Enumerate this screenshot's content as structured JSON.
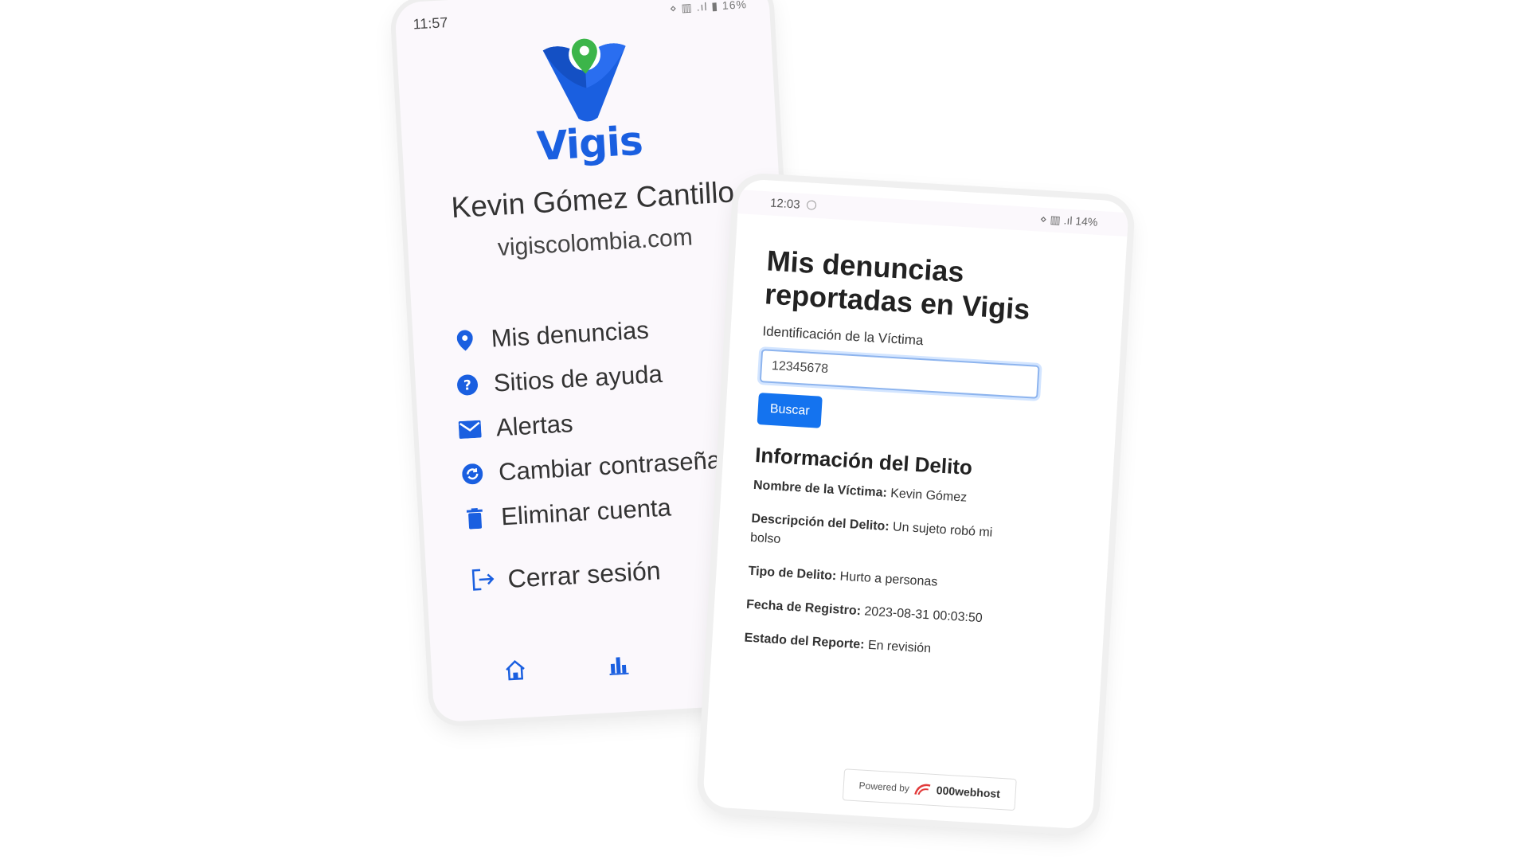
{
  "phone1": {
    "status_time": "11:57",
    "status_icons": "⋄ ▥ .ıl ▮ 16%",
    "logo_text": "Vigis",
    "user_name": "Kevin Gómez Cantillo",
    "user_site": "vigiscolombia.com",
    "menu": [
      {
        "label": "Mis denuncias",
        "icon": "location-pin-icon"
      },
      {
        "label": "Sitios de ayuda",
        "icon": "help-circle-icon"
      },
      {
        "label": "Alertas",
        "icon": "mail-icon"
      },
      {
        "label": "Cambiar contraseña",
        "icon": "refresh-icon"
      },
      {
        "label": "Eliminar cuenta",
        "icon": "trash-icon"
      }
    ],
    "logout_label": "Cerrar sesión",
    "bottom_nav": [
      "home-icon",
      "chart-icon",
      "shield-icon"
    ],
    "accent_color": "#1a5fe0"
  },
  "phone2": {
    "status_time": "12:03",
    "status_icons": "⋄ ▥ .ıl 14%",
    "title": "Mis denuncias reportadas en Vigis",
    "field_label": "Identificación de la Víctima",
    "input_value": "12345678",
    "search_button": "Buscar",
    "info_title": "Información del Delito",
    "info": [
      {
        "key": "Nombre de la Víctima:",
        "value": " Kevin Gómez"
      },
      {
        "key": "Descripción del Delito:",
        "value": " Un sujeto robó mi bolso"
      },
      {
        "key": "Tipo de Delito:",
        "value": " Hurto a personas"
      },
      {
        "key": "Fecha de Registro:",
        "value": " 2023-08-31 00:03:50"
      },
      {
        "key": "Estado del Reporte:",
        "value": " En revisión"
      }
    ],
    "powered_by": "Powered by",
    "powered_brand": "000webhost",
    "button_color": "#1473ef"
  }
}
